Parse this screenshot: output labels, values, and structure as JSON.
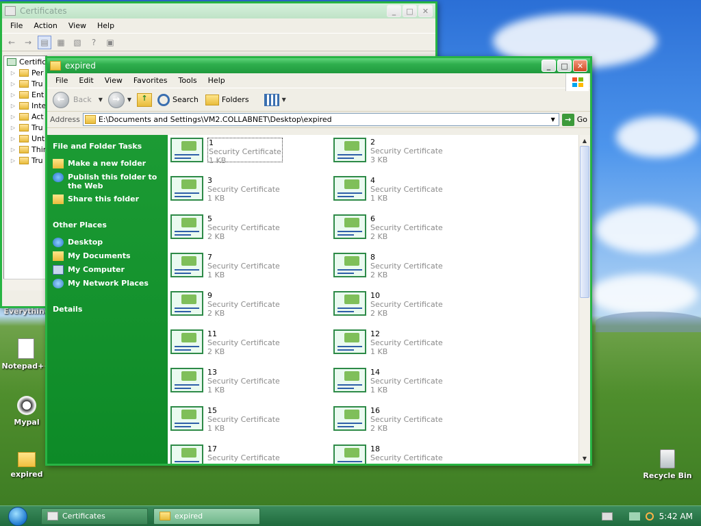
{
  "desktop": {
    "icons": [
      {
        "label": "Everything"
      },
      {
        "label": "Notepad++"
      },
      {
        "label": "Mypal"
      },
      {
        "label": "expired"
      },
      {
        "label": "Recycle Bin"
      }
    ]
  },
  "cert_window": {
    "title": "Certificates",
    "menu": [
      "File",
      "Action",
      "View",
      "Help"
    ],
    "tree": [
      "Certific",
      "Per",
      "Tru",
      "Ent",
      "Inte",
      "Act",
      "Tru",
      "Unt",
      "Thir",
      "Tru"
    ]
  },
  "explorer": {
    "title": "expired",
    "menu": [
      "File",
      "Edit",
      "View",
      "Favorites",
      "Tools",
      "Help"
    ],
    "toolbar": {
      "back": "Back",
      "search": "Search",
      "folders": "Folders"
    },
    "address": {
      "label": "Address",
      "path": "E:\\Documents and Settings\\VM2.COLLABNET\\Desktop\\expired",
      "go": "Go"
    },
    "tasks": {
      "header": "File and Folder Tasks",
      "items": [
        "Make a new folder",
        "Publish this folder to the Web",
        "Share this folder"
      ]
    },
    "places": {
      "header": "Other Places",
      "items": [
        "Desktop",
        "My Documents",
        "My Computer",
        "My Network Places"
      ]
    },
    "details": {
      "header": "Details"
    },
    "files": [
      {
        "name": "1",
        "type": "Security Certificate",
        "size": "1 KB"
      },
      {
        "name": "2",
        "type": "Security Certificate",
        "size": "3 KB"
      },
      {
        "name": "3",
        "type": "Security Certificate",
        "size": "1 KB"
      },
      {
        "name": "4",
        "type": "Security Certificate",
        "size": "1 KB"
      },
      {
        "name": "5",
        "type": "Security Certificate",
        "size": "2 KB"
      },
      {
        "name": "6",
        "type": "Security Certificate",
        "size": "2 KB"
      },
      {
        "name": "7",
        "type": "Security Certificate",
        "size": "1 KB"
      },
      {
        "name": "8",
        "type": "Security Certificate",
        "size": "2 KB"
      },
      {
        "name": "9",
        "type": "Security Certificate",
        "size": "2 KB"
      },
      {
        "name": "10",
        "type": "Security Certificate",
        "size": "2 KB"
      },
      {
        "name": "11",
        "type": "Security Certificate",
        "size": "2 KB"
      },
      {
        "name": "12",
        "type": "Security Certificate",
        "size": "1 KB"
      },
      {
        "name": "13",
        "type": "Security Certificate",
        "size": "1 KB"
      },
      {
        "name": "14",
        "type": "Security Certificate",
        "size": "1 KB"
      },
      {
        "name": "15",
        "type": "Security Certificate",
        "size": "1 KB"
      },
      {
        "name": "16",
        "type": "Security Certificate",
        "size": "2 KB"
      },
      {
        "name": "17",
        "type": "Security Certificate",
        "size": ""
      },
      {
        "name": "18",
        "type": "Security Certificate",
        "size": ""
      }
    ]
  },
  "taskbar": {
    "buttons": [
      "Certificates",
      "expired"
    ],
    "clock": "5:42 AM"
  }
}
